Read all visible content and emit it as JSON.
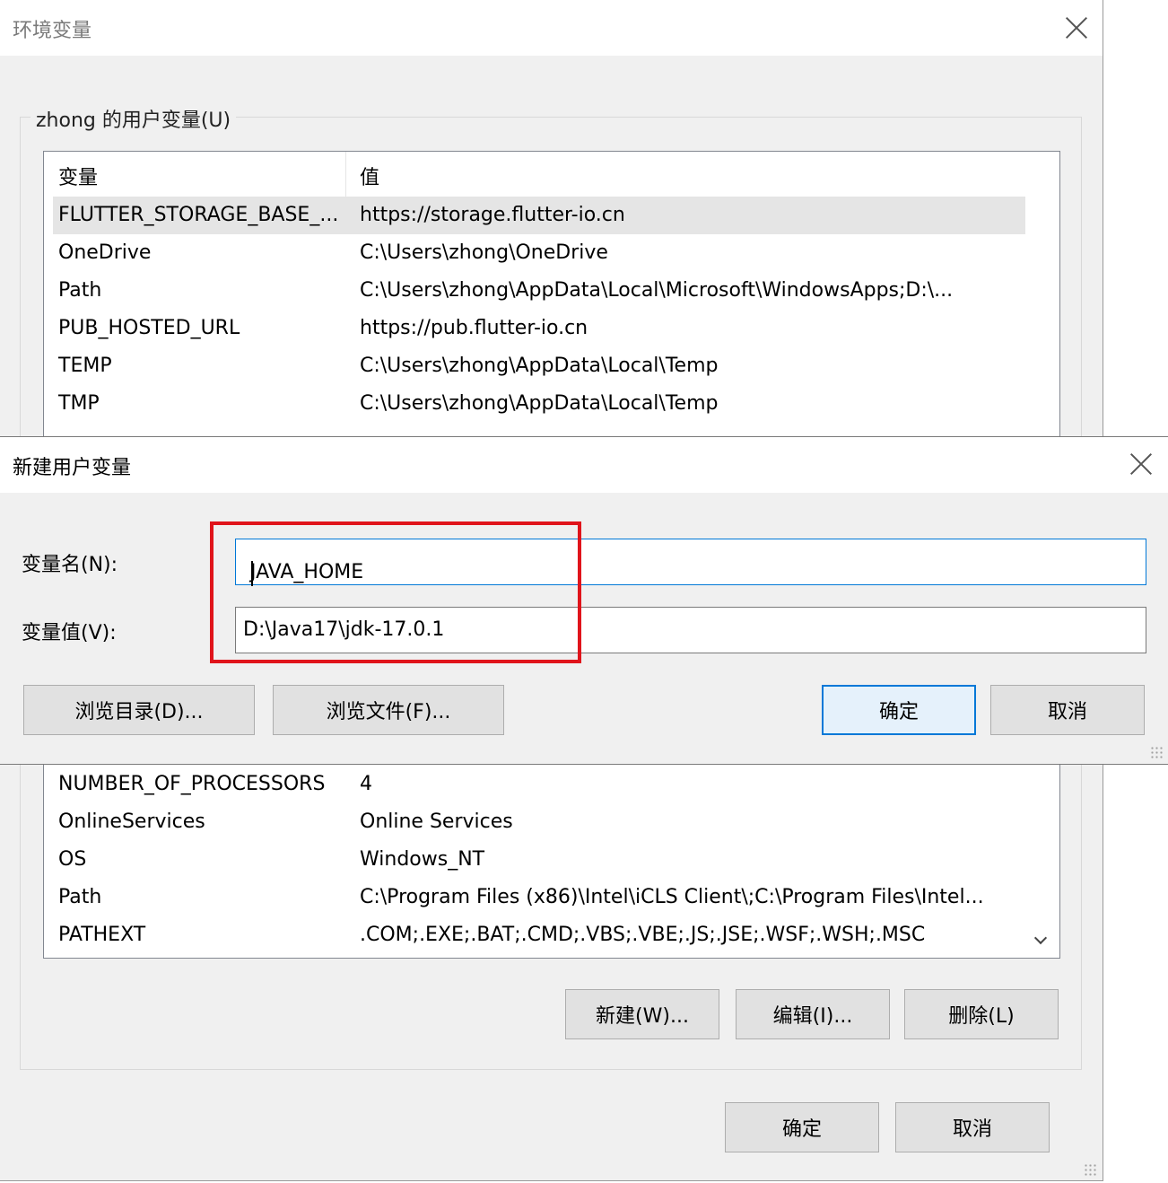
{
  "env_dialog": {
    "title": "环境变量",
    "user_vars_label": "zhong 的用户变量(U)",
    "columns": [
      "变量",
      "值"
    ],
    "user_vars": [
      {
        "name": "FLUTTER_STORAGE_BASE_...",
        "value": "https://storage.flutter-io.cn",
        "selected": true
      },
      {
        "name": "OneDrive",
        "value": "C:\\Users\\zhong\\OneDrive"
      },
      {
        "name": "Path",
        "value": "C:\\Users\\zhong\\AppData\\Local\\Microsoft\\WindowsApps;D:\\..."
      },
      {
        "name": "PUB_HOSTED_URL",
        "value": "https://pub.flutter-io.cn"
      },
      {
        "name": "TEMP",
        "value": "C:\\Users\\zhong\\AppData\\Local\\Temp"
      },
      {
        "name": "TMP",
        "value": "C:\\Users\\zhong\\AppData\\Local\\Temp"
      }
    ],
    "system_vars": [
      {
        "name": "NUMBER_OF_PROCESSORS",
        "value": "4"
      },
      {
        "name": "OnlineServices",
        "value": "Online Services"
      },
      {
        "name": "OS",
        "value": "Windows_NT"
      },
      {
        "name": "Path",
        "value": "C:\\Program Files (x86)\\Intel\\iCLS Client\\;C:\\Program Files\\Intel..."
      },
      {
        "name": "PATHEXT",
        "value": ".COM;.EXE;.BAT;.CMD;.VBS;.VBE;.JS;.JSE;.WSF;.WSH;.MSC"
      }
    ],
    "system_buttons": {
      "new": "新建(W)...",
      "edit": "编辑(I)...",
      "delete": "删除(L)"
    },
    "ok": "确定",
    "cancel": "取消"
  },
  "new_var_dialog": {
    "title": "新建用户变量",
    "name_label": "变量名(N):",
    "name_value": "JAVA_HOME",
    "value_label": "变量值(V):",
    "value_value": "D:\\Java17\\jdk-17.0.1",
    "browse_dir": "浏览目录(D)...",
    "browse_file": "浏览文件(F)...",
    "ok": "确定",
    "cancel": "取消"
  },
  "colors": {
    "highlight": "#e0141b",
    "focus": "#0078d7"
  }
}
